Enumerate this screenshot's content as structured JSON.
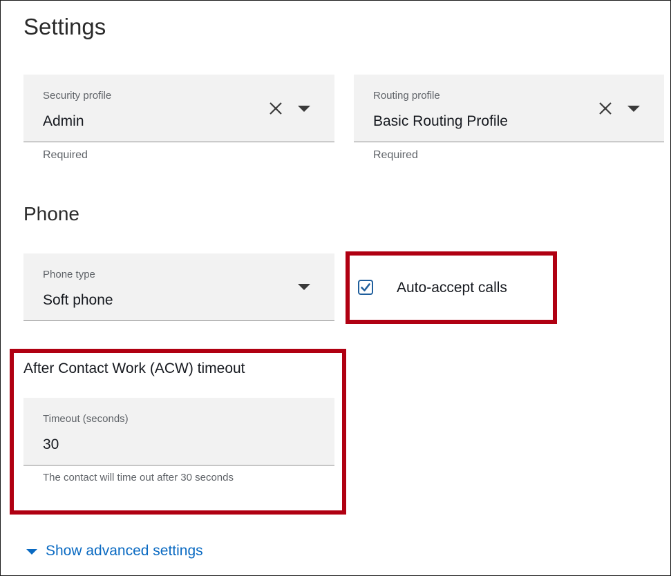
{
  "page": {
    "title": "Settings"
  },
  "security_profile": {
    "label": "Security profile",
    "value": "Admin",
    "helper": "Required"
  },
  "routing_profile": {
    "label": "Routing profile",
    "value": "Basic Routing Profile",
    "helper": "Required"
  },
  "phone": {
    "heading": "Phone",
    "type_label": "Phone type",
    "type_value": "Soft phone",
    "auto_accept_label": "Auto-accept calls",
    "auto_accept_checked": true
  },
  "acw": {
    "title": "After Contact Work (ACW) timeout",
    "timeout_label": "Timeout (seconds)",
    "timeout_value": "30",
    "helper": "The contact will time out after 30 seconds"
  },
  "advanced": {
    "link_label": "Show advanced settings"
  },
  "colors": {
    "highlight": "#b00012",
    "link": "#0a6ac2",
    "field_bg": "#f2f2f2"
  }
}
